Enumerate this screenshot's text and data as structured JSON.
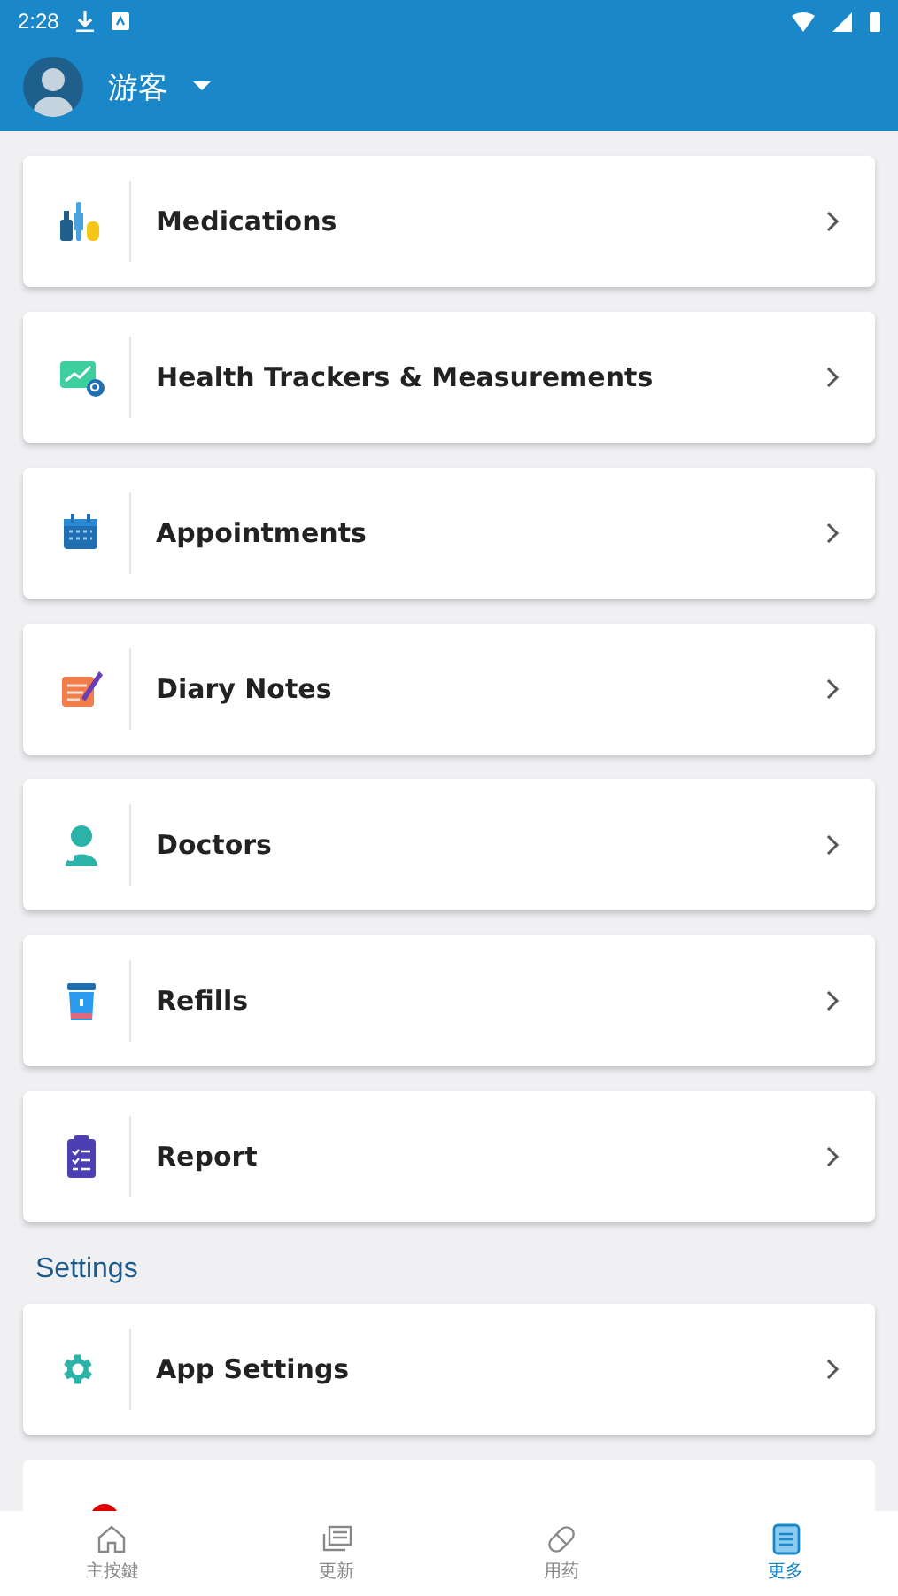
{
  "status_bar": {
    "time": "2:28"
  },
  "header": {
    "user_name": "游客"
  },
  "menu_items": [
    {
      "kind": "medication",
      "label": "Medications"
    },
    {
      "kind": "tracker",
      "label": "Health Trackers & Measurements"
    },
    {
      "kind": "calendar",
      "label": "Appointments"
    },
    {
      "kind": "diary",
      "label": "Diary Notes"
    },
    {
      "kind": "doctor",
      "label": "Doctors"
    },
    {
      "kind": "refill",
      "label": "Refills"
    },
    {
      "kind": "report",
      "label": "Report"
    }
  ],
  "settings": {
    "heading": "Settings",
    "items": [
      {
        "kind": "gear",
        "label": "App Settings"
      },
      {
        "kind": "red-dot"
      }
    ]
  },
  "bottom_nav": [
    {
      "kind": "home",
      "label": "主按鍵",
      "selected": false
    },
    {
      "kind": "news",
      "label": "更新",
      "selected": false
    },
    {
      "kind": "pill",
      "label": "用药",
      "selected": false
    },
    {
      "kind": "more",
      "label": "更多",
      "selected": true
    }
  ]
}
